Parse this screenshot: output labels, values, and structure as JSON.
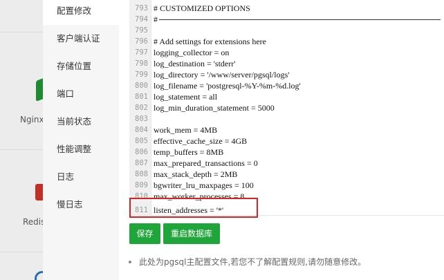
{
  "background": {
    "labels": {
      "nginx": "Nginx",
      "redis": "Redis"
    }
  },
  "tabs": [
    {
      "label": "配置修改",
      "active": true
    },
    {
      "label": "客户端认证"
    },
    {
      "label": "存储位置"
    },
    {
      "label": "端口"
    },
    {
      "label": "当前状态"
    },
    {
      "label": "性能调整"
    },
    {
      "label": "日志"
    },
    {
      "label": "慢日志"
    }
  ],
  "editor": {
    "lines": [
      {
        "n": "793",
        "text": "# CUSTOMIZED OPTIONS"
      },
      {
        "n": "794",
        "text": "#"
      },
      {
        "n": "795",
        "text": ""
      },
      {
        "n": "796",
        "text": "# Add settings for extensions here"
      },
      {
        "n": "797",
        "text": "logging_collector = on"
      },
      {
        "n": "798",
        "text": "log_destination = 'stderr'"
      },
      {
        "n": "799",
        "text": "log_directory = '/www/server/pgsql/logs'"
      },
      {
        "n": "800",
        "text": "log_filename = 'postgresql-%Y-%m-%d.log'"
      },
      {
        "n": "801",
        "text": "log_statement = all"
      },
      {
        "n": "802",
        "text": "log_min_duration_statement = 5000"
      },
      {
        "n": "803",
        "text": ""
      },
      {
        "n": "804",
        "text": "work_mem = 4MB"
      },
      {
        "n": "805",
        "text": "effective_cache_size = 4GB"
      },
      {
        "n": "806",
        "text": "temp_buffers = 8MB"
      },
      {
        "n": "807",
        "text": "max_prepared_transactions = 0"
      },
      {
        "n": "808",
        "text": "max_stack_depth = 2MB"
      },
      {
        "n": "809",
        "text": "bgwriter_lru_maxpages = 100"
      },
      {
        "n": "810",
        "text": "max_worker_processes = 8"
      },
      {
        "n": "811",
        "text": "listen_addresses = '*'"
      }
    ]
  },
  "buttons": {
    "save": "保存",
    "restart": "重启数据库"
  },
  "note": "此处为pgsql主配置文件,若您不了解配置规则,请勿随意修改。",
  "colors": {
    "accent": "#20a53a",
    "highlight": "#e02020"
  }
}
